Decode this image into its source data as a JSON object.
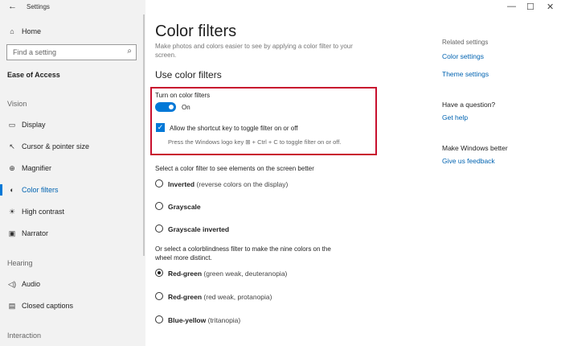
{
  "window": {
    "title": "Settings"
  },
  "sidebar": {
    "home_label": "Home",
    "search_placeholder": "Find a setting",
    "category_title": "Ease of Access",
    "sections": [
      {
        "heading": "Vision",
        "items": [
          "Display",
          "Cursor & pointer size",
          "Magnifier",
          "Color filters",
          "High contrast",
          "Narrator"
        ]
      },
      {
        "heading": "Hearing",
        "items": [
          "Audio",
          "Closed captions"
        ]
      },
      {
        "heading": "Interaction",
        "items": []
      }
    ],
    "active_item": "Color filters"
  },
  "main": {
    "title": "Color filters",
    "description": "Make photos and colors easier to see by applying a color filter to your screen.",
    "section_title": "Use color filters",
    "toggle_label": "Turn on color filters",
    "toggle_state": "On",
    "shortcut_checkbox_label": "Allow the shortcut key to toggle filter on or off",
    "shortcut_hint": "Press the Windows logo key ⊞ + Ctrl + C to toggle filter on or off.",
    "filter_prompt": "Select a color filter to see elements on the screen better",
    "filters": [
      {
        "name": "Inverted",
        "detail": "(reverse colors on the display)",
        "selected": false
      },
      {
        "name": "Grayscale",
        "detail": "",
        "selected": false
      },
      {
        "name": "Grayscale inverted",
        "detail": "",
        "selected": false
      }
    ],
    "colorblind_prompt_line1": "Or select a colorblindness filter to make the nine colors on the",
    "colorblind_prompt_line2": "wheel more distinct.",
    "colorblind_filters": [
      {
        "name": "Red-green",
        "detail": "(green weak, deuteranopia)",
        "selected": true
      },
      {
        "name": "Red-green",
        "detail": "(red weak, protanopia)",
        "selected": false
      },
      {
        "name": "Blue-yellow",
        "detail": "(tritanopia)",
        "selected": false
      }
    ]
  },
  "right_panel": {
    "related_heading": "Related settings",
    "related_links": [
      "Color settings",
      "Theme settings"
    ],
    "question_heading": "Have a question?",
    "question_link": "Get help",
    "feedback_heading": "Make Windows better",
    "feedback_link": "Give us feedback"
  },
  "colors": {
    "accent": "#0078d7",
    "link": "#0063b1",
    "highlight_border": "#c8102e",
    "sidebar_bg": "#f2f2f2"
  }
}
